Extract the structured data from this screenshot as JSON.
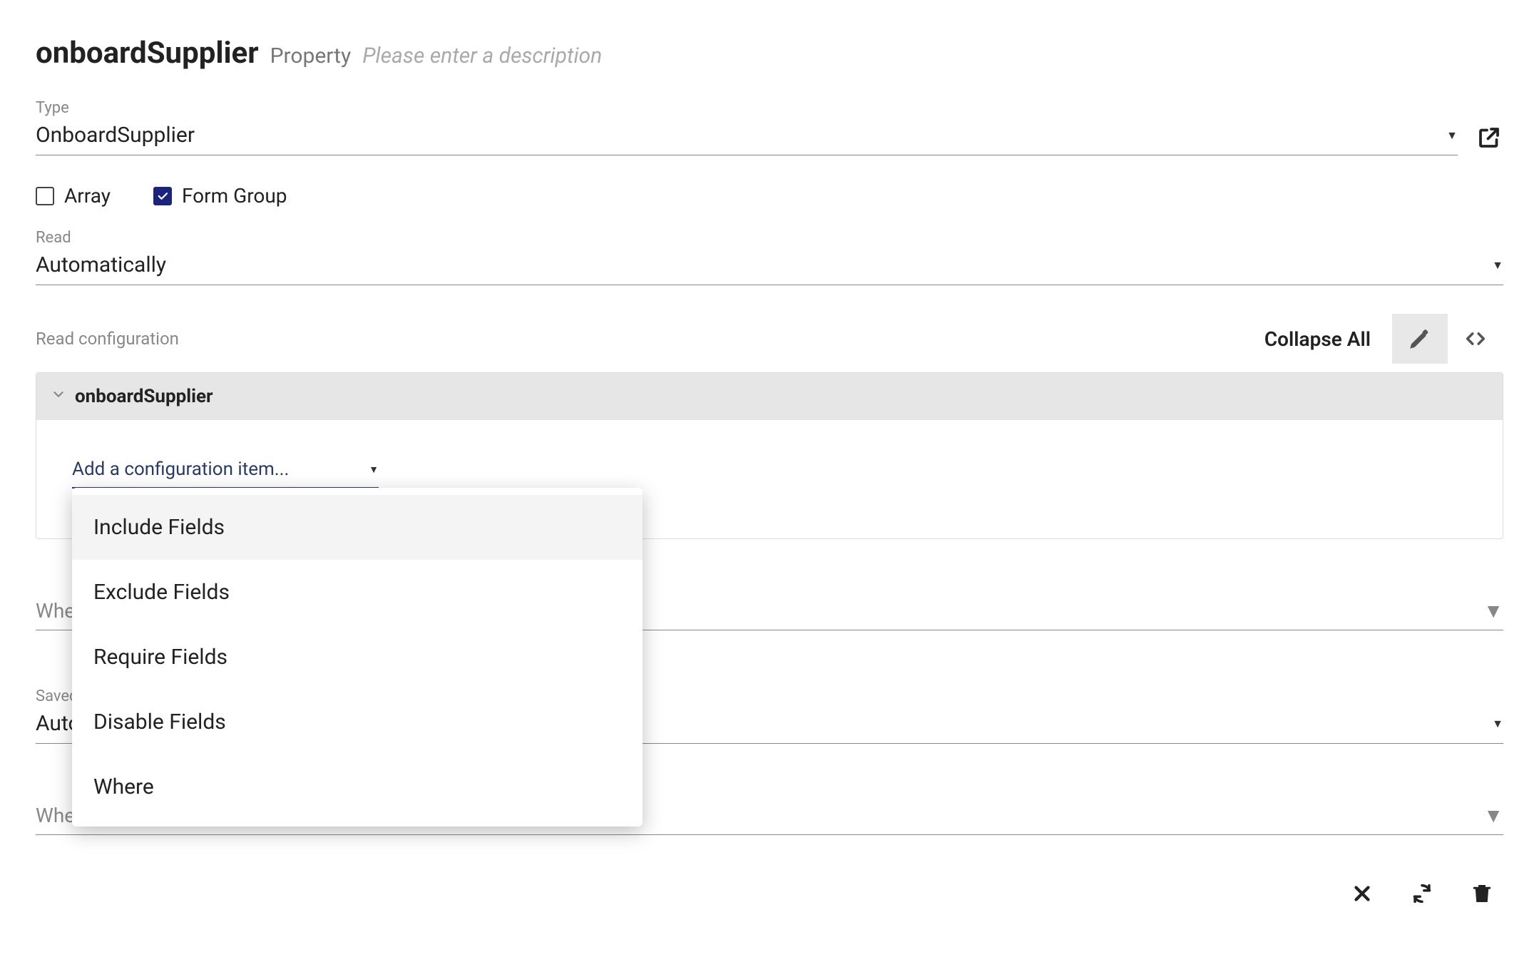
{
  "header": {
    "title": "onboardSupplier",
    "subtitle": "Property",
    "description_placeholder": "Please enter a description"
  },
  "type_field": {
    "label": "Type",
    "value": "OnboardSupplier"
  },
  "checkboxes": {
    "array": {
      "label": "Array",
      "checked": false
    },
    "form_group": {
      "label": "Form Group",
      "checked": true
    }
  },
  "read_field": {
    "label": "Read",
    "value": "Automatically"
  },
  "read_config": {
    "label": "Read configuration",
    "collapse_all": "Collapse All",
    "root_name": "onboardSupplier",
    "add_placeholder": "Add a configuration item...",
    "options": [
      "Include Fields",
      "Exclude Fields",
      "Require Fields",
      "Disable Fields",
      "Where"
    ]
  },
  "when_failed_placeholder": "Whe",
  "saved_field": {
    "label": "Saved",
    "value": "Auto"
  },
  "when_failed2_placeholder": "Whe"
}
